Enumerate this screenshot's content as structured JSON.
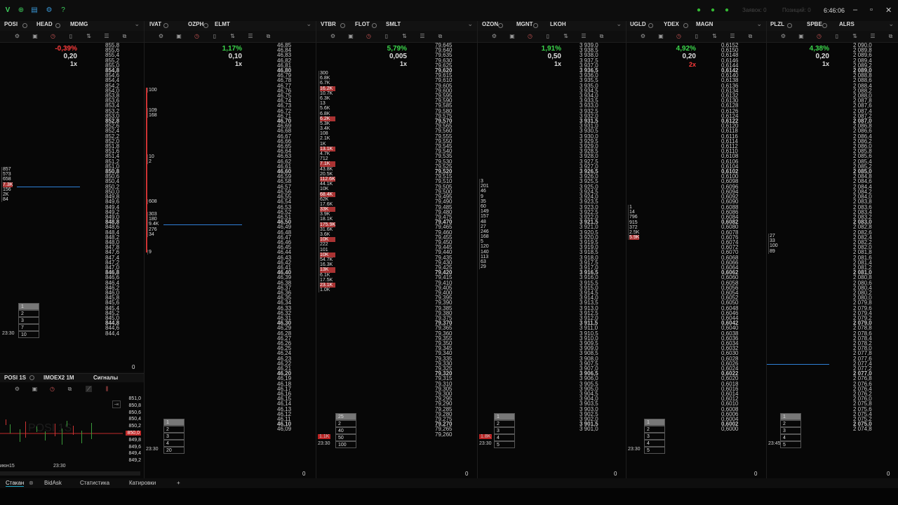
{
  "titlebar": {
    "right_text_1": "Заявок: 0",
    "right_text_2": "Позиций: 0",
    "clock": "6:46:06",
    "icons": [
      "app-logo-icon",
      "add-icon",
      "window-icon",
      "gear-icon",
      "help-icon"
    ],
    "status_colors": [
      "#35b935",
      "#35b935",
      "#35b935"
    ]
  },
  "panels": [
    {
      "tabs": [
        "POSI",
        "HEAD",
        "MDMG"
      ],
      "pct": "-0,39%",
      "pct_color": "#ff3b3b",
      "step": "0,20",
      "mult": "1x",
      "bottom": "0",
      "prices_top": "855,8",
      "prices_bottom": "844,4"
    },
    {
      "tabs": [
        "IVAT",
        "OZPH",
        "ELMT"
      ],
      "pct": "1,17%",
      "pct_color": "#3bd84b",
      "step": "0,10",
      "mult": "1x",
      "bottom": "0",
      "prices_top": "46,85",
      "prices_bottom": "46,09"
    },
    {
      "tabs": [
        "VTBR",
        "FLOT",
        "SMLT"
      ],
      "pct": "5,79%",
      "pct_color": "#3bd84b",
      "step": "0,005",
      "mult": "1x",
      "bottom": "0",
      "prices_top": "79,645",
      "prices_bottom": "79,260"
    },
    {
      "tabs": [
        "OZON",
        "MGNT",
        "LKOH"
      ],
      "pct": "1,91%",
      "pct_color": "#3bd84b",
      "step": "0,50",
      "mult": "1x",
      "bottom": "0",
      "prices_top": "3 939,0",
      "prices_bottom": "3 901,0"
    },
    {
      "tabs": [
        "UGLD",
        "YDEX",
        "MAGN"
      ],
      "pct": "4,92%",
      "pct_color": "#3bd84b",
      "step": "0,20",
      "mult": "2x",
      "bottom": "0",
      "prices_top": "0,6152",
      "prices_bottom": "0,6000"
    },
    {
      "tabs": [
        "PLZL",
        "SPBE",
        "ALRS"
      ],
      "pct": "4,38%",
      "pct_color": "#3bd84b",
      "step": "0,20",
      "mult": "1x",
      "bottom": "0",
      "prices_top": "2 090,0",
      "prices_bottom": "2 074,0"
    }
  ],
  "panel1_ladder": [
    "855,8",
    "855,6",
    "855,4",
    "855,2",
    "855,0",
    "854,8",
    "854,6",
    "854,4",
    "854,2",
    "854,0",
    "853,8",
    "853,6",
    "853,4",
    "853,2",
    "853,0",
    "852,8",
    "852,6",
    "852,4",
    "852,2",
    "852,0",
    "851,8",
    "851,6",
    "851,4",
    "851,2",
    "851,0",
    "850,8",
    "850,6",
    "850,4",
    "850,2",
    "850,0",
    "849,8",
    "849,6",
    "849,4",
    "849,2",
    "849,0",
    "848,8",
    "848,6",
    "848,4",
    "848,2",
    "848,0",
    "847,8",
    "847,6",
    "847,4",
    "847,2",
    "847,0",
    "846,8",
    "846,6",
    "846,4",
    "846,2",
    "846,0",
    "845,8",
    "845,6",
    "845,4",
    "845,2",
    "845,0",
    "844,8",
    "844,6",
    "844,4"
  ],
  "panel2_ladder": [
    "46,85",
    "46,84",
    "46,83",
    "46,82",
    "46,81",
    "46,80",
    "46,79",
    "46,78",
    "46,77",
    "46,76",
    "46,75",
    "46,74",
    "46,73",
    "46,72",
    "46,71",
    "46,70",
    "46,69",
    "46,68",
    "46,67",
    "46,66",
    "46,65",
    "46,64",
    "46,63",
    "46,62",
    "46,61",
    "46,60",
    "46,59",
    "46,58",
    "46,57",
    "46,56",
    "46,55",
    "46,54",
    "46,53",
    "46,52",
    "46,51",
    "46,50",
    "46,49",
    "46,48",
    "46,47",
    "46,46",
    "46,45",
    "46,44",
    "46,43",
    "46,42",
    "46,41",
    "46,40",
    "46,39",
    "46,38",
    "46,37",
    "46,36",
    "46,35",
    "46,34",
    "46,33",
    "46,32",
    "46,31",
    "46,30",
    "46,29",
    "46,28",
    "46,27",
    "46,26",
    "46,25",
    "46,24",
    "46,23",
    "46,22",
    "46,21",
    "46,20",
    "46,19",
    "46,18",
    "46,17",
    "46,16",
    "46,15",
    "46,14",
    "46,13",
    "46,12",
    "46,11",
    "46,10",
    "46,09"
  ],
  "panel3_ladder": [
    "79,645",
    "79,640",
    "79,635",
    "79,630",
    "79,625",
    "79,620",
    "79,615",
    "79,610",
    "79,605",
    "79,600",
    "79,595",
    "79,590",
    "79,585",
    "79,580",
    "79,575",
    "79,570",
    "79,565",
    "79,560",
    "79,555",
    "79,550",
    "79,545",
    "79,540",
    "79,535",
    "79,530",
    "79,525",
    "79,520",
    "79,515",
    "79,510",
    "79,505",
    "79,500",
    "79,495",
    "79,490",
    "79,485",
    "79,480",
    "79,475",
    "79,470",
    "79,465",
    "79,460",
    "79,455",
    "79,450",
    "79,445",
    "79,440",
    "79,435",
    "79,430",
    "79,425",
    "79,420",
    "79,415",
    "79,410",
    "79,405",
    "79,400",
    "79,395",
    "79,390",
    "79,385",
    "79,380",
    "79,375",
    "79,370",
    "79,365",
    "79,360",
    "79,355",
    "79,350",
    "79,345",
    "79,340",
    "79,335",
    "79,330",
    "79,325",
    "79,320",
    "79,315",
    "79,310",
    "79,305",
    "79,300",
    "79,295",
    "79,290",
    "79,285",
    "79,280",
    "79,275",
    "79,270",
    "79,265",
    "79,260"
  ],
  "panel4_ladder": [
    "3 939,0",
    "3 938,5",
    "3 938,0",
    "3 937,5",
    "3 937,0",
    "3 936,5",
    "3 936,0",
    "3 935,5",
    "3 935,0",
    "3 934,5",
    "3 934,0",
    "3 933,5",
    "3 933,0",
    "3 932,5",
    "3 932,0",
    "3 931,5",
    "3 931,0",
    "3 930,5",
    "3 930,0",
    "3 929,5",
    "3 929,0",
    "3 928,5",
    "3 928,0",
    "3 927,5",
    "3 927,0",
    "3 926,5",
    "3 926,0",
    "3 925,5",
    "3 925,0",
    "3 924,5",
    "3 924,0",
    "3 923,5",
    "3 923,0",
    "3 922,5",
    "3 922,0",
    "3 921,5",
    "3 921,0",
    "3 920,5",
    "3 920,0",
    "3 919,5",
    "3 919,0",
    "3 918,5",
    "3 918,0",
    "3 917,5",
    "3 917,0",
    "3 916,5",
    "3 916,0",
    "3 915,5",
    "3 915,0",
    "3 914,5",
    "3 914,0",
    "3 913,5",
    "3 913,0",
    "3 912,5",
    "3 912,0",
    "3 911,5",
    "3 911,0",
    "3 910,5",
    "3 910,0",
    "3 909,5",
    "3 909,0",
    "3 908,5",
    "3 908,0",
    "3 907,5",
    "3 907,0",
    "3 906,5",
    "3 906,0",
    "3 905,5",
    "3 905,0",
    "3 904,5",
    "3 904,0",
    "3 903,5",
    "3 903,0",
    "3 902,5",
    "3 902,0",
    "3 901,5",
    "3 901,0"
  ],
  "panel5_ladder": [
    "0,6152",
    "0,6150",
    "0,6148",
    "0,6146",
    "0,6144",
    "0,6142",
    "0,6140",
    "0,6138",
    "0,6136",
    "0,6134",
    "0,6132",
    "0,6130",
    "0,6128",
    "0,6126",
    "0,6124",
    "0,6122",
    "0,6120",
    "0,6118",
    "0,6116",
    "0,6114",
    "0,6112",
    "0,6110",
    "0,6108",
    "0,6106",
    "0,6104",
    "0,6102",
    "0,6100",
    "0,6098",
    "0,6096",
    "0,6094",
    "0,6092",
    "0,6090",
    "0,6088",
    "0,6086",
    "0,6084",
    "0,6082",
    "0,6080",
    "0,6078",
    "0,6076",
    "0,6074",
    "0,6072",
    "0,6070",
    "0,6068",
    "0,6066",
    "0,6064",
    "0,6062",
    "0,6060",
    "0,6058",
    "0,6056",
    "0,6054",
    "0,6052",
    "0,6050",
    "0,6048",
    "0,6046",
    "0,6044",
    "0,6042",
    "0,6040",
    "0,6038",
    "0,6036",
    "0,6034",
    "0,6032",
    "0,6030",
    "0,6028",
    "0,6026",
    "0,6024",
    "0,6022",
    "0,6020",
    "0,6018",
    "0,6016",
    "0,6014",
    "0,6012",
    "0,6010",
    "0,6008",
    "0,6006",
    "0,6004",
    "0,6002",
    "0,6000"
  ],
  "panel6_ladder": [
    "2 090,0",
    "2 089,8",
    "2 089,6",
    "2 089,4",
    "2 089,2",
    "2 089,0",
    "2 088,8",
    "2 088,6",
    "2 088,4",
    "2 088,2",
    "2 088,0",
    "2 087,8",
    "2 087,6",
    "2 087,4",
    "2 087,2",
    "2 087,0",
    "2 086,8",
    "2 086,6",
    "2 086,4",
    "2 086,2",
    "2 086,0",
    "2 085,8",
    "2 085,6",
    "2 085,4",
    "2 085,2",
    "2 085,0",
    "2 084,8",
    "2 084,6",
    "2 084,4",
    "2 084,2",
    "2 084,0",
    "2 083,8",
    "2 083,6",
    "2 083,4",
    "2 083,2",
    "2 083,0",
    "2 082,8",
    "2 082,6",
    "2 082,4",
    "2 082,2",
    "2 082,0",
    "2 081,8",
    "2 081,6",
    "2 081,4",
    "2 081,2",
    "2 081,0",
    "2 080,8",
    "2 080,6",
    "2 080,4",
    "2 080,2",
    "2 080,0",
    "2 079,8",
    "2 079,6",
    "2 079,4",
    "2 079,2",
    "2 079,0",
    "2 078,8",
    "2 078,6",
    "2 078,4",
    "2 078,2",
    "2 078,0",
    "2 077,8",
    "2 077,6",
    "2 077,4",
    "2 077,2",
    "2 077,0",
    "2 076,8",
    "2 076,6",
    "2 076,4",
    "2 076,2",
    "2 076,0",
    "2 075,8",
    "2 075,6",
    "2 075,4",
    "2 075,2",
    "2 075,0",
    "2 074,8"
  ],
  "vol_p1": [
    "857",
    "5?3",
    "658",
    "7.3K",
    "156",
    "2K",
    "84"
  ],
  "vol_p2_a": [
    "100"
  ],
  "vol_p2_b": [
    "109",
    "168"
  ],
  "vol_p2_c": [
    "10",
    "2"
  ],
  "vol_p2_d": [
    "608"
  ],
  "vol_p2_e": [
    "303",
    "180",
    "9.4K",
    "276",
    "34"
  ],
  "vol_p2_f": [
    "9"
  ],
  "vol_p3": [
    "300",
    "6.8K",
    "6.7K",
    "16.2K",
    "10.7K",
    "6.3K",
    "13",
    "5.6K",
    "6.8K",
    "6.2K",
    "5.3K",
    "3.4K",
    "108",
    "2.1K",
    "1K",
    "13.1K",
    "4.7K",
    "712",
    "7.1K",
    "43.8K",
    "20.5K",
    "112.6K",
    "44.1K",
    "10K",
    "68.4K",
    "62K",
    "17.6K",
    "33K",
    "3.9K",
    "18.1K",
    "175.9K",
    "31.6K",
    "3.6K",
    "10K",
    "222",
    "101",
    "10K",
    "54.7K",
    "16.3K",
    "13K",
    "6.1K",
    "17.5K",
    "23.1K",
    "1.0K"
  ],
  "vol_p4": [
    "3",
    "201",
    "46",
    "9",
    "35",
    "60",
    "149",
    "157",
    "48",
    "27",
    "246",
    "168",
    "5",
    "120",
    "140",
    "113",
    "63",
    "29"
  ],
  "vol_p5": [
    "1",
    "14",
    "796",
    "915",
    "372",
    "2.5K",
    "5.9K"
  ],
  "vol_p6": [
    "27",
    "33",
    "100",
    "89"
  ],
  "trades": {
    "p1": [
      "1",
      "2",
      "3",
      "7",
      "10"
    ],
    "p1_time": "23:30",
    "p2": [
      "1",
      "2",
      "3",
      "4",
      "20"
    ],
    "p2_time": "23:30",
    "p3": [
      "25",
      "2",
      "40",
      "50",
      "100"
    ],
    "p3_left": "1.1K",
    "p3_time": "23:30",
    "p4": [
      "1",
      "2",
      "3",
      "4",
      "5"
    ],
    "p4_left": "1.8K",
    "p4_time": "23:30",
    "p5": [
      "1",
      "2",
      "3",
      "4",
      "5"
    ],
    "p5_time": "23:30",
    "p6": [
      "1",
      "2",
      "3",
      "4",
      "5"
    ],
    "p6_time": "23:45"
  },
  "mini_chart": {
    "tabs": [
      "POSI 1S",
      "IMOEX2 1M",
      "Сигналы"
    ],
    "prices": [
      "851,0",
      "850,8",
      "850,6",
      "850,4",
      "850,2",
      "850,0",
      "849,8",
      "849,6",
      "849,4",
      "849,2"
    ],
    "selected_price": "850,0",
    "x_labels": [
      "июн15",
      "23:30"
    ],
    "ghost_text": "POSI 1S"
  },
  "taskbar": {
    "items": [
      "Стакан",
      "BidAsk",
      "Статистика",
      "Катировки"
    ],
    "add": "+"
  }
}
